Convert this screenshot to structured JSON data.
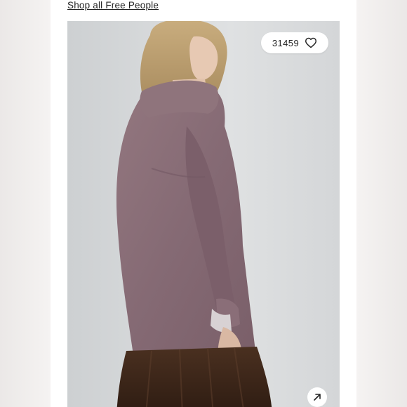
{
  "shop_link": {
    "label": "Shop all Free People"
  },
  "listing": {
    "likes": "31459",
    "like_icon": "heart-outline-icon",
    "expand_icon": "arrow-up-right-icon"
  },
  "photo": {
    "alt": "Model wearing mauve oversized ribbed knit sweater with sheer brown tulle skirt",
    "colors": {
      "sweater": "#8a6e79",
      "background": "#d6d8d9",
      "skirt": "#3a2518"
    }
  }
}
